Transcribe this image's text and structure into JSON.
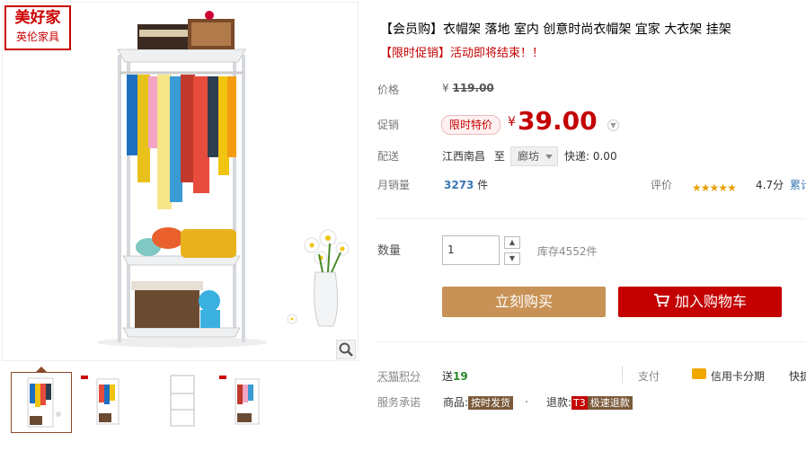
{
  "brand": {
    "name_line1": "美好家",
    "name_line2": "英伦家具"
  },
  "product": {
    "title": "【会员购】衣帽架 落地 室内 创意时尚衣帽架 宜家 大衣架 挂架",
    "promo_text": "【限时促销】活动即将结束！！"
  },
  "price": {
    "label": "价格",
    "currency": "¥",
    "original": "119.00"
  },
  "promo_price": {
    "label": "促销",
    "badge": "限时特价",
    "currency": "¥",
    "value": "39.00"
  },
  "shipping": {
    "label": "配送",
    "from": "江西南昌",
    "to_word": "至",
    "destination": "廊坊",
    "express": "快递: 0.00"
  },
  "sales": {
    "label": "月销量",
    "count": "3273",
    "unit": "件",
    "rating_label": "评价",
    "stars": 5,
    "rating": "4.7分",
    "more": "累计"
  },
  "quantity": {
    "label": "数量",
    "value": "1",
    "stock": "库存4552件"
  },
  "buttons": {
    "buy_now": "立刻购买",
    "add_cart": "加入购物车"
  },
  "points": {
    "label": "天猫积分",
    "prefix": "送",
    "value": "19"
  },
  "payment": {
    "label": "支付",
    "credit": "信用卡分期",
    "fast": "快捷"
  },
  "service": {
    "label": "服务承诺",
    "goods_prefix": "商品:",
    "goods_tag": "按时发货",
    "refund_prefix": "退款:",
    "refund_badge": "T3",
    "refund_tag": "极速退款"
  },
  "colors": {
    "accent_red": "#c40000",
    "buy_button": "#c89256",
    "points_green": "#2a8a2a"
  }
}
